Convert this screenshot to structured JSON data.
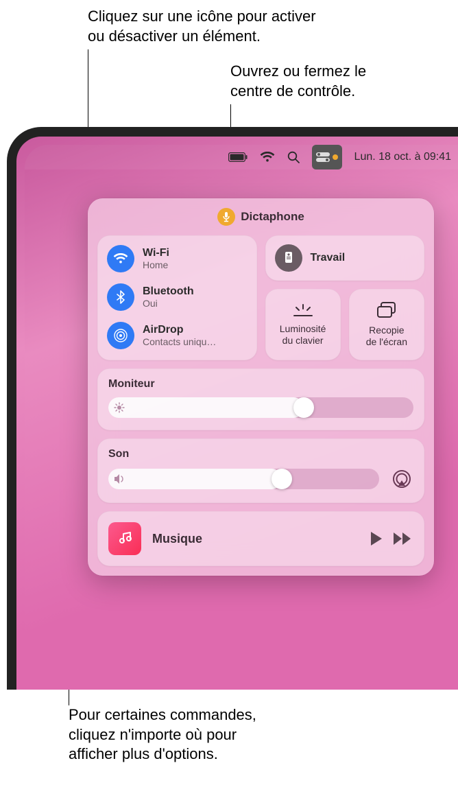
{
  "callouts": {
    "toggle_icon": "Cliquez sur une icône pour activer\nou désactiver un élément.",
    "open_cc": "Ouvrez ou fermez le\ncentre de contrôle.",
    "more_options": "Pour certaines commandes,\ncliquez n'importe où pour\nafficher plus d'options."
  },
  "menubar": {
    "clock": "Lun. 18 oct. à  09:41"
  },
  "recording": {
    "app": "Dictaphone"
  },
  "connectivity": {
    "wifi": {
      "title": "Wi-Fi",
      "sub": "Home"
    },
    "bluetooth": {
      "title": "Bluetooth",
      "sub": "Oui"
    },
    "airdrop": {
      "title": "AirDrop",
      "sub": "Contacts uniqu…"
    }
  },
  "focus": {
    "label": "Travail"
  },
  "small": {
    "keyboard_brightness": "Luminosité\ndu clavier",
    "screen_mirroring": "Recopie\nde l'écran"
  },
  "sliders": {
    "display": {
      "label": "Moniteur",
      "value": 0.64
    },
    "sound": {
      "label": "Son",
      "value": 0.64
    }
  },
  "music": {
    "title": "Musique"
  }
}
